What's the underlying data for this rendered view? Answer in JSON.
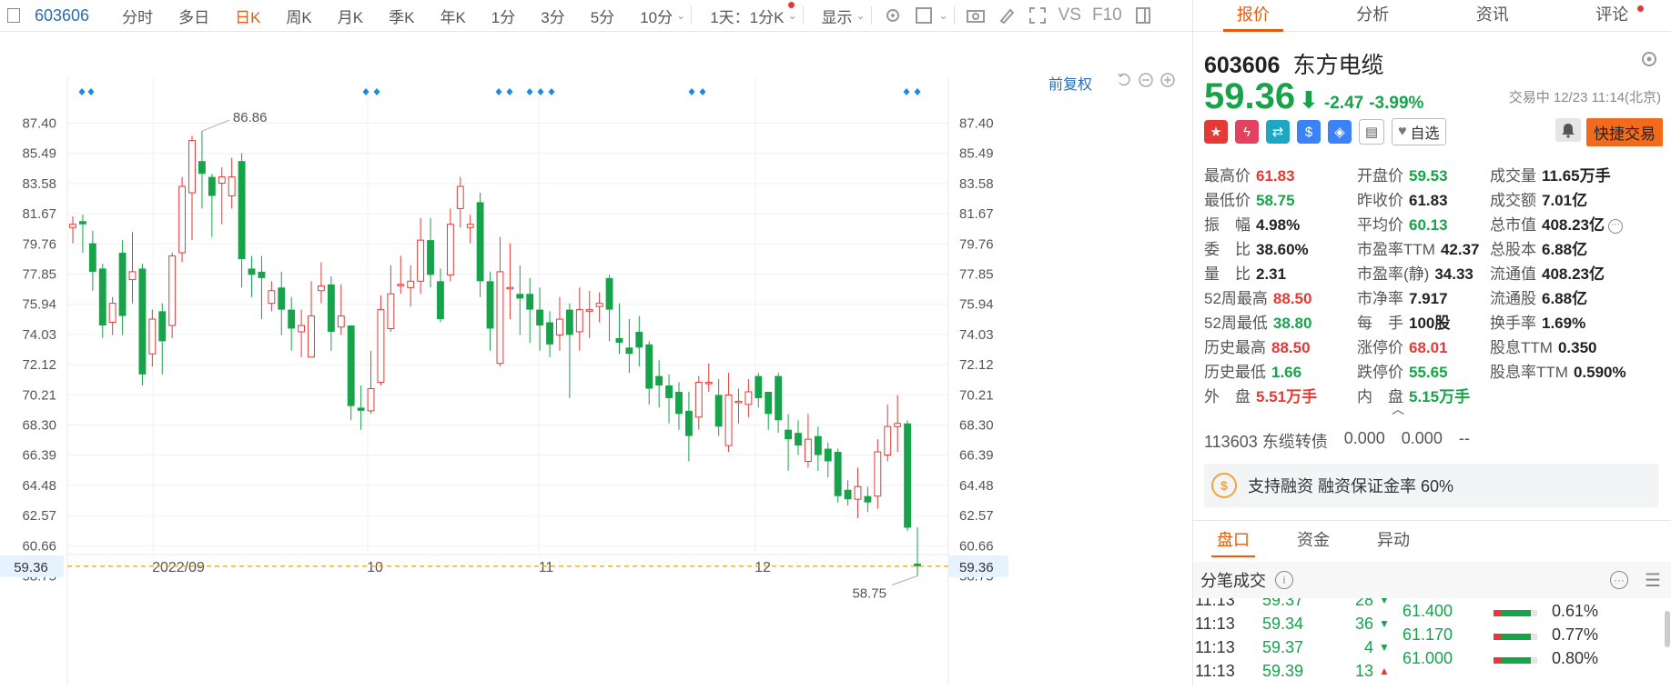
{
  "toolbar": {
    "code": "603606",
    "tabs": [
      "分时",
      "多日",
      "日K",
      "周K",
      "月K",
      "季K",
      "年K",
      "1分",
      "3分",
      "5分",
      "10分"
    ],
    "active_tab": "日K",
    "interval_dropdown": "1天：1分K",
    "display_label": "显示",
    "vs_label": "VS",
    "f10_label": "F10"
  },
  "chart": {
    "qfq_label": "前复权",
    "ylim": [
      57.8,
      89.0
    ],
    "y_ticks": [
      "87.40",
      "85.49",
      "83.58",
      "81.67",
      "79.76",
      "77.85",
      "75.94",
      "74.03",
      "72.12",
      "70.21",
      "68.30",
      "66.39",
      "64.48",
      "62.57",
      "60.66",
      "58.75"
    ],
    "x_labels": [
      "2022/09",
      "10",
      "11",
      "12"
    ],
    "current_price_label": "59.36",
    "max_label": "86.86",
    "min_label": "58.75",
    "candles": [
      [
        80.8,
        81.0,
        81.5,
        79.8
      ],
      [
        81.2,
        81.0,
        81.6,
        79.2
      ],
      [
        79.8,
        78.0,
        80.6,
        76.8
      ],
      [
        78.2,
        74.6,
        78.5,
        73.8
      ],
      [
        74.8,
        76.0,
        76.4,
        74.0
      ],
      [
        79.2,
        75.2,
        80.0,
        74.0
      ],
      [
        77.5,
        78.0,
        80.5,
        76.0
      ],
      [
        78.2,
        71.5,
        78.5,
        70.8
      ],
      [
        72.8,
        75.0,
        75.6,
        72.0
      ],
      [
        75.5,
        73.6,
        76.0,
        71.5
      ],
      [
        74.6,
        79.0,
        79.2,
        73.8
      ],
      [
        79.2,
        83.4,
        84.0,
        78.6
      ],
      [
        83.0,
        86.3,
        86.6,
        80.0
      ],
      [
        85.0,
        84.2,
        86.9,
        82.0
      ],
      [
        84.0,
        82.8,
        84.2,
        80.2
      ],
      [
        83.6,
        84.0,
        84.6,
        81.0
      ],
      [
        82.8,
        84.0,
        85.2,
        82.0
      ],
      [
        85.0,
        78.8,
        85.5,
        77.0
      ],
      [
        78.2,
        77.8,
        79.0,
        76.4
      ],
      [
        78.0,
        77.6,
        79.0,
        75.0
      ],
      [
        76.0,
        76.8,
        77.4,
        75.5
      ],
      [
        77.0,
        75.6,
        78.0,
        74.0
      ],
      [
        75.6,
        74.4,
        76.4,
        73.0
      ],
      [
        74.2,
        74.6,
        75.6,
        72.6
      ],
      [
        72.6,
        75.2,
        77.4,
        72.6
      ],
      [
        76.8,
        77.1,
        78.6,
        76.0
      ],
      [
        77.2,
        74.2,
        77.7,
        73.0
      ],
      [
        74.5,
        75.2,
        77.2,
        74.0
      ],
      [
        74.6,
        69.5,
        74.6,
        68.6
      ],
      [
        69.4,
        69.2,
        70.8,
        68.0
      ],
      [
        69.2,
        70.6,
        73.0,
        69.0
      ],
      [
        71.0,
        75.6,
        76.5,
        70.8
      ],
      [
        74.4,
        76.6,
        78.4,
        74.2
      ],
      [
        77.2,
        77.2,
        79.0,
        76.6
      ],
      [
        77.0,
        77.4,
        78.4,
        75.8
      ],
      [
        77.4,
        80.0,
        81.4,
        76.6
      ],
      [
        80.0,
        77.8,
        81.4,
        77.0
      ],
      [
        77.4,
        75.0,
        78.2,
        74.8
      ],
      [
        77.8,
        81.0,
        82.0,
        77.4
      ],
      [
        82.0,
        83.4,
        84.0,
        80.8
      ],
      [
        80.8,
        81.0,
        81.6,
        79.8
      ],
      [
        82.4,
        77.4,
        83.0,
        76.4
      ],
      [
        77.4,
        74.4,
        78.0,
        73.0
      ],
      [
        72.2,
        78.0,
        80.2,
        72.0
      ],
      [
        77.0,
        77.0,
        79.8,
        75.0
      ],
      [
        76.6,
        76.3,
        78.4,
        74.0
      ],
      [
        76.6,
        75.6,
        77.6,
        73.5
      ],
      [
        75.6,
        74.6,
        77.0,
        73.0
      ],
      [
        74.8,
        73.4,
        75.5,
        72.6
      ],
      [
        74.0,
        75.0,
        76.4,
        73.0
      ],
      [
        75.6,
        74.0,
        76.0,
        70.0
      ],
      [
        74.2,
        75.6,
        77.0,
        73.0
      ],
      [
        75.5,
        75.6,
        76.8,
        73.8
      ],
      [
        75.8,
        76.0,
        76.7,
        74.8
      ],
      [
        77.6,
        75.6,
        77.8,
        73.6
      ],
      [
        73.8,
        73.5,
        76.0,
        72.8
      ],
      [
        73.2,
        72.8,
        75.0,
        71.6
      ],
      [
        74.2,
        73.2,
        75.2,
        72.0
      ],
      [
        73.4,
        70.6,
        73.6,
        69.6
      ],
      [
        71.4,
        70.8,
        72.4,
        69.4
      ],
      [
        70.8,
        70.0,
        71.5,
        68.4
      ],
      [
        70.4,
        69.0,
        71.0,
        68.0
      ],
      [
        69.2,
        67.6,
        70.4,
        66.0
      ],
      [
        68.8,
        71.0,
        71.4,
        68.0
      ],
      [
        71.0,
        71.0,
        72.2,
        70.4
      ],
      [
        70.2,
        68.2,
        71.2,
        67.6
      ],
      [
        67.0,
        70.2,
        71.6,
        66.6
      ],
      [
        69.8,
        69.8,
        70.6,
        68.4
      ],
      [
        69.6,
        70.4,
        71.2,
        68.8
      ],
      [
        71.4,
        70.0,
        71.6,
        69.4
      ],
      [
        70.4,
        69.0,
        70.4,
        68.0
      ],
      [
        71.4,
        68.6,
        71.6,
        67.8
      ],
      [
        68.0,
        67.4,
        69.0,
        65.4
      ],
      [
        67.8,
        67.0,
        68.6,
        66.4
      ],
      [
        66.0,
        67.4,
        69.0,
        65.6
      ],
      [
        67.6,
        66.4,
        68.2,
        65.4
      ],
      [
        66.8,
        66.0,
        67.2,
        65.0
      ],
      [
        66.6,
        63.8,
        66.8,
        63.4
      ],
      [
        64.2,
        63.6,
        64.8,
        63.2
      ],
      [
        63.6,
        64.4,
        65.6,
        62.4
      ],
      [
        63.8,
        63.4,
        64.4,
        62.8
      ],
      [
        63.8,
        66.6,
        67.4,
        63.0
      ],
      [
        66.4,
        68.2,
        69.6,
        66.0
      ],
      [
        68.2,
        68.4,
        70.2,
        66.6
      ],
      [
        68.4,
        61.8,
        68.6,
        61.6
      ],
      [
        59.53,
        59.36,
        61.83,
        58.75
      ]
    ]
  },
  "right": {
    "tabs": [
      "报价",
      "分析",
      "资讯",
      "评论"
    ],
    "active_tab": "报价",
    "code": "603606",
    "name": "东方电缆",
    "price": "59.36",
    "change": "-2.47",
    "change_pct": "-3.99%",
    "status": "交易中 12/23 11:14(北京)",
    "watchlist_label": "自选",
    "quick_trade_label": "快捷交易",
    "stats": [
      [
        [
          "最高价",
          "61.83",
          "red"
        ],
        [
          "开盘价",
          "59.53",
          "green"
        ],
        [
          "成交量",
          "11.65万手",
          ""
        ]
      ],
      [
        [
          "最低价",
          "58.75",
          "green"
        ],
        [
          "昨收价",
          "61.83",
          ""
        ],
        [
          "成交额",
          "7.01亿",
          ""
        ]
      ],
      [
        [
          "振　幅",
          "4.98%",
          ""
        ],
        [
          "平均价",
          "60.13",
          "green"
        ],
        [
          "总市值",
          "408.23亿",
          ""
        ]
      ],
      [
        [
          "委　比",
          "38.60%",
          ""
        ],
        [
          "市盈率TTM",
          "42.37",
          ""
        ],
        [
          "总股本",
          "6.88亿",
          ""
        ]
      ],
      [
        [
          "量　比",
          "2.31",
          ""
        ],
        [
          "市盈率(静)",
          "34.33",
          ""
        ],
        [
          "流通值",
          "408.23亿",
          ""
        ]
      ],
      [
        [
          "52周最高",
          "88.50",
          "red"
        ],
        [
          "市净率",
          "7.917",
          ""
        ],
        [
          "流通股",
          "6.88亿",
          ""
        ]
      ],
      [
        [
          "52周最低",
          "38.80",
          "green"
        ],
        [
          "每　手",
          "100股",
          ""
        ],
        [
          "换手率",
          "1.69%",
          ""
        ]
      ],
      [
        [
          "历史最高",
          "88.50",
          "red"
        ],
        [
          "涨停价",
          "68.01",
          "red"
        ],
        [
          "股息TTM",
          "0.350",
          ""
        ]
      ],
      [
        [
          "历史最低",
          "1.66",
          "green"
        ],
        [
          "跌停价",
          "55.65",
          "green"
        ],
        [
          "股息率TTM",
          "0.590%",
          ""
        ]
      ],
      [
        [
          "外　盘",
          "5.51万手",
          "red"
        ],
        [
          "内　盘",
          "5.15万手",
          "green"
        ],
        [
          "",
          "",
          ""
        ]
      ]
    ],
    "bond": {
      "name": "113603 东缆转债",
      "v1": "0.000",
      "v2": "0.000",
      "v3": "--"
    },
    "margin_text": "支持融资 融资保证金率 60%",
    "subtabs": [
      "盘口",
      "资金",
      "异动"
    ],
    "active_subtab": "盘口",
    "trades_title": "分笔成交",
    "trades": [
      {
        "time": "11:13",
        "price": "59.37",
        "vol": "28"
      },
      {
        "time": "11:13",
        "price": "59.34",
        "vol": "36"
      },
      {
        "time": "11:13",
        "price": "59.37",
        "vol": "4"
      },
      {
        "time": "11:13",
        "price": "59.39",
        "vol": "13"
      }
    ],
    "depth": [
      {
        "price": "61.400",
        "pct": "0.61%",
        "fill": 0.85
      },
      {
        "price": "61.170",
        "pct": "0.77%",
        "fill": 0.85
      },
      {
        "price": "61.000",
        "pct": "0.80%",
        "fill": 0.85
      }
    ]
  },
  "colors": {
    "up": "#e53935",
    "down": "#16a34a",
    "accent": "#e8590c",
    "link": "#2b6cb0"
  }
}
